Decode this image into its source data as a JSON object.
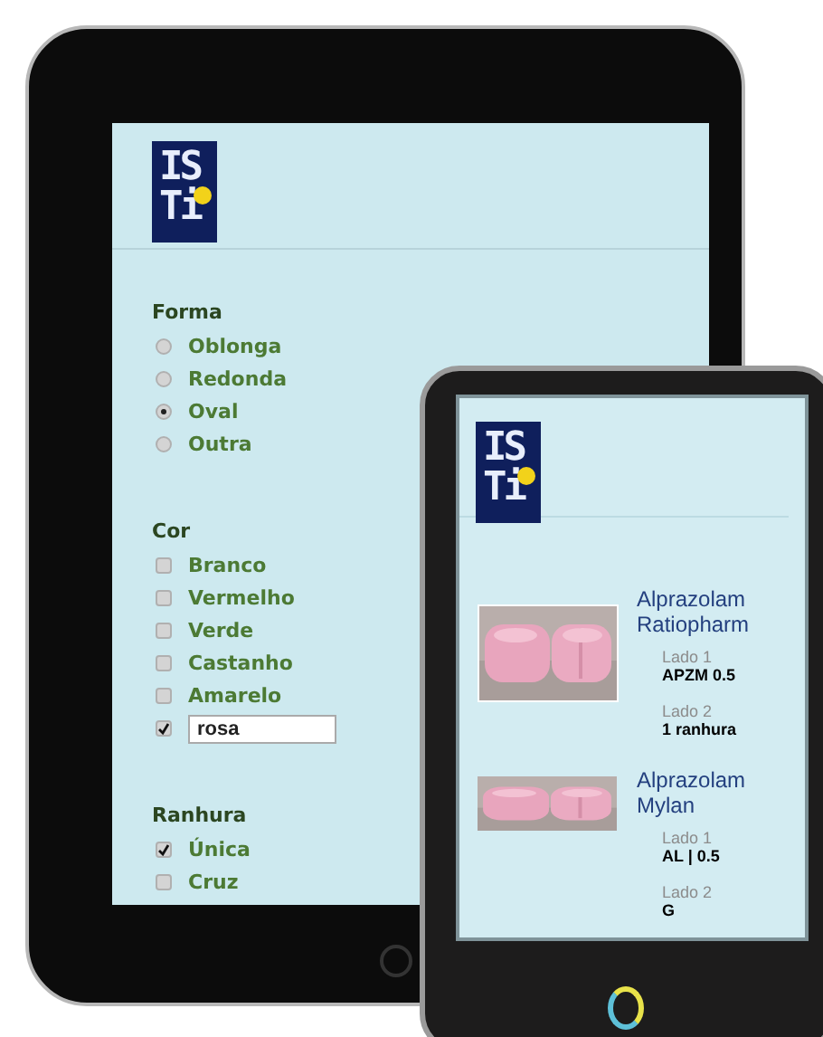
{
  "tablet": {
    "logo": [
      "IS",
      "Ti"
    ],
    "groups": [
      {
        "title": "Forma",
        "kind": "radio",
        "options": [
          {
            "label": "Oblonga",
            "selected": false
          },
          {
            "label": "Redonda",
            "selected": false
          },
          {
            "label": "Oval",
            "selected": true
          },
          {
            "label": "Outra",
            "selected": false
          }
        ]
      },
      {
        "title": "Cor",
        "kind": "checkbox",
        "options": [
          {
            "label": "Branco",
            "checked": false
          },
          {
            "label": "Vermelho",
            "checked": false
          },
          {
            "label": "Verde",
            "checked": false
          },
          {
            "label": "Castanho",
            "checked": false
          },
          {
            "label": "Amarelo",
            "checked": false
          },
          {
            "value": "rosa",
            "checked": true
          }
        ]
      },
      {
        "title": "Ranhura",
        "kind": "checkbox",
        "options": [
          {
            "label": "Única",
            "checked": true
          },
          {
            "label": "Cruz",
            "checked": false
          }
        ]
      }
    ]
  },
  "phone": {
    "logo": [
      "IS",
      "Ti"
    ],
    "results": [
      {
        "name": "Alprazolam Ratiopharm",
        "photo": {
          "kind": "picture"
        },
        "sides": [
          {
            "label": "Lado 1",
            "value": "APZM 0.5"
          },
          {
            "label": "Lado 2",
            "value": "1 ranhura"
          }
        ]
      },
      {
        "name": "Alprazolam Mylan",
        "photo": {
          "kind": "picture"
        },
        "sides": [
          {
            "label": "Lado 1",
            "value": "AL | 0.5"
          },
          {
            "label": "Lado 2",
            "value": "G"
          }
        ]
      }
    ]
  }
}
